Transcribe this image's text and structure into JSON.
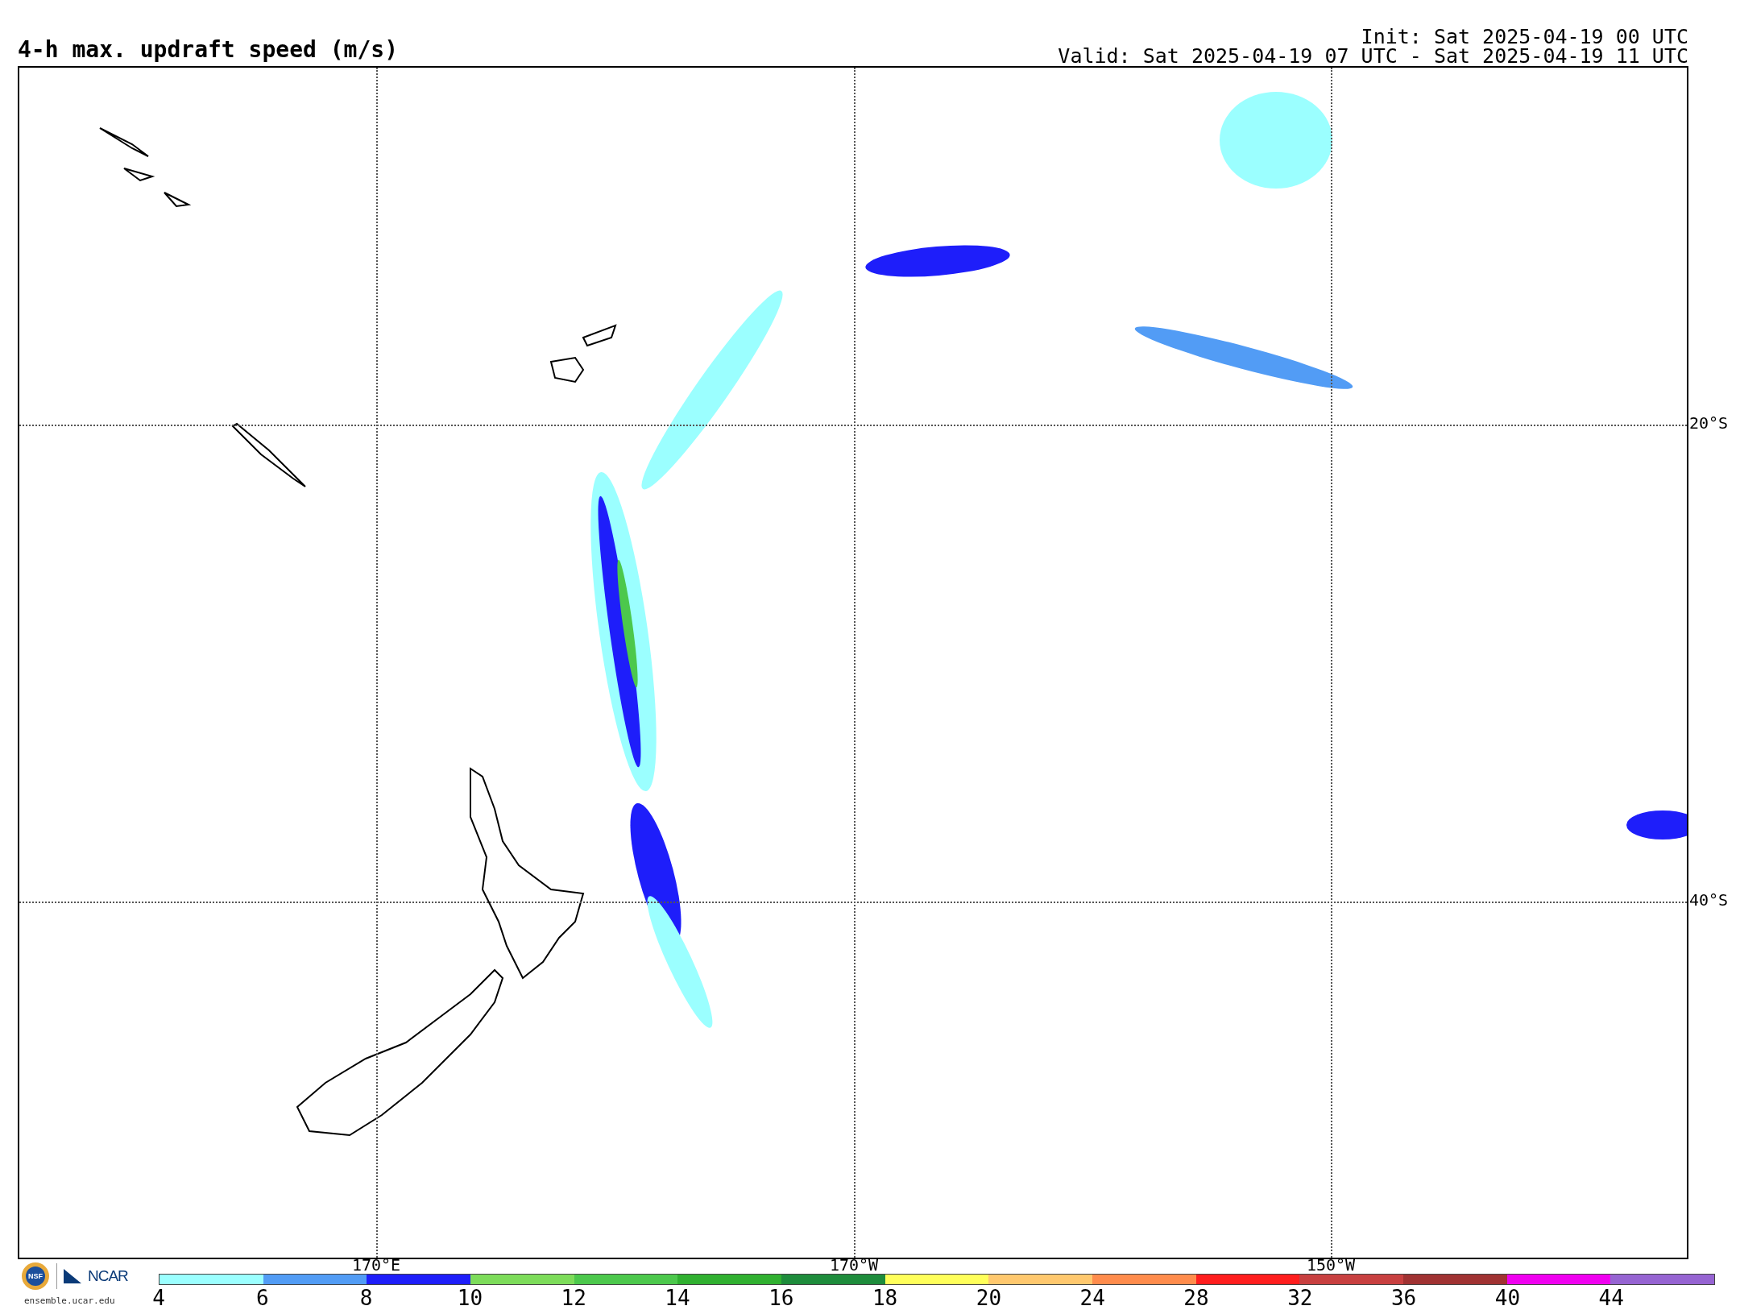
{
  "title": "4-h max. updraft speed (m/s)",
  "init": "Init: Sat 2025-04-19 00 UTC",
  "valid": "Valid: Sat 2025-04-19 07 UTC - Sat 2025-04-19 11 UTC",
  "map": {
    "lon_labels": [
      "170°E",
      "170°W",
      "150°W"
    ],
    "lat_labels": [
      "20°S",
      "40°S"
    ]
  },
  "logos": {
    "nsf": "NSF",
    "ncar": "NCAR",
    "site": "ensemble.ucar.edu"
  },
  "colorbar": {
    "segments": [
      {
        "label": "4",
        "color": "#9bffff"
      },
      {
        "label": "6",
        "color": "#529cf5"
      },
      {
        "label": "8",
        "color": "#1e1efa"
      },
      {
        "label": "10",
        "color": "#7ddc5a"
      },
      {
        "label": "12",
        "color": "#4cc84c"
      },
      {
        "label": "14",
        "color": "#30b030"
      },
      {
        "label": "16",
        "color": "#1e8c3c"
      },
      {
        "label": "18",
        "color": "#ffff5a"
      },
      {
        "label": "20",
        "color": "#ffc86e"
      },
      {
        "label": "24",
        "color": "#ff8c4c"
      },
      {
        "label": "28",
        "color": "#ff1e1e"
      },
      {
        "label": "32",
        "color": "#c84040"
      },
      {
        "label": "36",
        "color": "#a03232"
      },
      {
        "label": "40",
        "color": "#f000f0"
      },
      {
        "label": "44",
        "color": "#9664d2"
      }
    ]
  }
}
